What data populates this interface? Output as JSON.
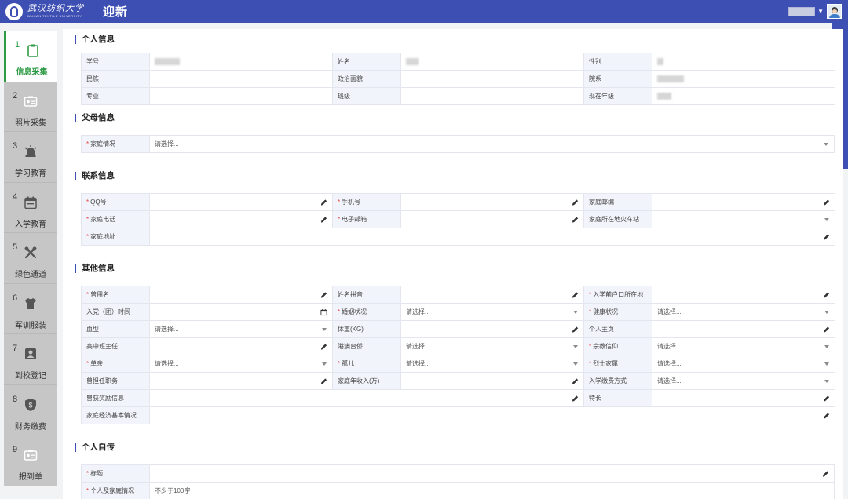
{
  "header": {
    "logo_cn": "武汉纺织大学",
    "logo_en": "WUHAN TEXTILE UNIVERSITY",
    "title": "迎新"
  },
  "sidebar": {
    "steps": [
      {
        "num": "1",
        "label": "信息采集",
        "icon": "clipboard-icon",
        "active": true
      },
      {
        "num": "2",
        "label": "照片采集",
        "icon": "id-card-icon"
      },
      {
        "num": "3",
        "label": "学习教育",
        "icon": "alarm-bell-icon"
      },
      {
        "num": "4",
        "label": "入学教育",
        "icon": "calendar-icon"
      },
      {
        "num": "5",
        "label": "绿色通道",
        "icon": "tools-icon"
      },
      {
        "num": "6",
        "label": "军训服装",
        "icon": "tshirt-icon"
      },
      {
        "num": "7",
        "label": "到校登记",
        "icon": "person-badge-icon"
      },
      {
        "num": "8",
        "label": "财务缴费",
        "icon": "money-shield-icon"
      },
      {
        "num": "9",
        "label": "报到单",
        "icon": "id-card-icon"
      }
    ]
  },
  "sections": {
    "personal": {
      "title": "个人信息",
      "fields": {
        "student_no": "学号",
        "name": "姓名",
        "gender": "性别",
        "ethnicity": "民族",
        "politics": "政治面貌",
        "department": "院系",
        "major": "专业",
        "class": "班级",
        "grade": "现在年级"
      }
    },
    "parents": {
      "title": "父母信息",
      "family_label": "家庭情况",
      "family_placeholder": "请选择..."
    },
    "contact": {
      "title": "联系信息",
      "fields": {
        "qq": "QQ号",
        "mobile": "手机号",
        "postcode": "家庭邮编",
        "home_phone": "家庭电话",
        "email": "电子邮箱",
        "station": "家庭所在地火车站",
        "address": "家庭地址"
      }
    },
    "other": {
      "title": "其他信息",
      "placeholder": "请选择...",
      "fields": {
        "former_name": "曾用名",
        "pinyin": "姓名拼音",
        "hukou": "入学前户口所在地",
        "party_date": "入党（团）时间",
        "marital": "婚姻状况",
        "health": "健康状况",
        "blood": "血型",
        "weight": "体重(KG)",
        "homepage": "个人主页",
        "hs_teacher": "高中班主任",
        "hmt": "港澳台侨",
        "religion": "宗教信仰",
        "single_parent": "单亲",
        "orphan": "孤儿",
        "martyr": "烈士家属",
        "positions": "曾担任职务",
        "income": "家庭年收入(万)",
        "fee_method": "入学缴费方式",
        "awards": "曾获奖励信息",
        "specialty": "特长",
        "economy": "家庭经济基本情况"
      }
    },
    "autobiography": {
      "title": "个人自传",
      "heading_label": "标题",
      "family_label": "个人及家庭情况",
      "family_placeholder": "不少于100字"
    }
  }
}
